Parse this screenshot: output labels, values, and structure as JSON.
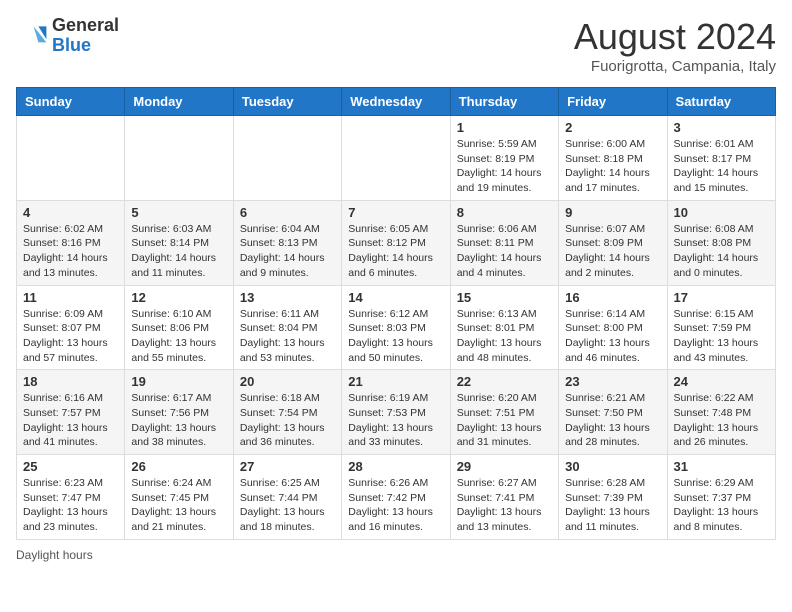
{
  "header": {
    "logo_general": "General",
    "logo_blue": "Blue",
    "month_year": "August 2024",
    "location": "Fuorigrotta, Campania, Italy"
  },
  "footer": {
    "daylight_label": "Daylight hours"
  },
  "days_of_week": [
    "Sunday",
    "Monday",
    "Tuesday",
    "Wednesday",
    "Thursday",
    "Friday",
    "Saturday"
  ],
  "weeks": [
    [
      {
        "day": "",
        "info": ""
      },
      {
        "day": "",
        "info": ""
      },
      {
        "day": "",
        "info": ""
      },
      {
        "day": "",
        "info": ""
      },
      {
        "day": "1",
        "info": "Sunrise: 5:59 AM\nSunset: 8:19 PM\nDaylight: 14 hours and 19 minutes."
      },
      {
        "day": "2",
        "info": "Sunrise: 6:00 AM\nSunset: 8:18 PM\nDaylight: 14 hours and 17 minutes."
      },
      {
        "day": "3",
        "info": "Sunrise: 6:01 AM\nSunset: 8:17 PM\nDaylight: 14 hours and 15 minutes."
      }
    ],
    [
      {
        "day": "4",
        "info": "Sunrise: 6:02 AM\nSunset: 8:16 PM\nDaylight: 14 hours and 13 minutes."
      },
      {
        "day": "5",
        "info": "Sunrise: 6:03 AM\nSunset: 8:14 PM\nDaylight: 14 hours and 11 minutes."
      },
      {
        "day": "6",
        "info": "Sunrise: 6:04 AM\nSunset: 8:13 PM\nDaylight: 14 hours and 9 minutes."
      },
      {
        "day": "7",
        "info": "Sunrise: 6:05 AM\nSunset: 8:12 PM\nDaylight: 14 hours and 6 minutes."
      },
      {
        "day": "8",
        "info": "Sunrise: 6:06 AM\nSunset: 8:11 PM\nDaylight: 14 hours and 4 minutes."
      },
      {
        "day": "9",
        "info": "Sunrise: 6:07 AM\nSunset: 8:09 PM\nDaylight: 14 hours and 2 minutes."
      },
      {
        "day": "10",
        "info": "Sunrise: 6:08 AM\nSunset: 8:08 PM\nDaylight: 14 hours and 0 minutes."
      }
    ],
    [
      {
        "day": "11",
        "info": "Sunrise: 6:09 AM\nSunset: 8:07 PM\nDaylight: 13 hours and 57 minutes."
      },
      {
        "day": "12",
        "info": "Sunrise: 6:10 AM\nSunset: 8:06 PM\nDaylight: 13 hours and 55 minutes."
      },
      {
        "day": "13",
        "info": "Sunrise: 6:11 AM\nSunset: 8:04 PM\nDaylight: 13 hours and 53 minutes."
      },
      {
        "day": "14",
        "info": "Sunrise: 6:12 AM\nSunset: 8:03 PM\nDaylight: 13 hours and 50 minutes."
      },
      {
        "day": "15",
        "info": "Sunrise: 6:13 AM\nSunset: 8:01 PM\nDaylight: 13 hours and 48 minutes."
      },
      {
        "day": "16",
        "info": "Sunrise: 6:14 AM\nSunset: 8:00 PM\nDaylight: 13 hours and 46 minutes."
      },
      {
        "day": "17",
        "info": "Sunrise: 6:15 AM\nSunset: 7:59 PM\nDaylight: 13 hours and 43 minutes."
      }
    ],
    [
      {
        "day": "18",
        "info": "Sunrise: 6:16 AM\nSunset: 7:57 PM\nDaylight: 13 hours and 41 minutes."
      },
      {
        "day": "19",
        "info": "Sunrise: 6:17 AM\nSunset: 7:56 PM\nDaylight: 13 hours and 38 minutes."
      },
      {
        "day": "20",
        "info": "Sunrise: 6:18 AM\nSunset: 7:54 PM\nDaylight: 13 hours and 36 minutes."
      },
      {
        "day": "21",
        "info": "Sunrise: 6:19 AM\nSunset: 7:53 PM\nDaylight: 13 hours and 33 minutes."
      },
      {
        "day": "22",
        "info": "Sunrise: 6:20 AM\nSunset: 7:51 PM\nDaylight: 13 hours and 31 minutes."
      },
      {
        "day": "23",
        "info": "Sunrise: 6:21 AM\nSunset: 7:50 PM\nDaylight: 13 hours and 28 minutes."
      },
      {
        "day": "24",
        "info": "Sunrise: 6:22 AM\nSunset: 7:48 PM\nDaylight: 13 hours and 26 minutes."
      }
    ],
    [
      {
        "day": "25",
        "info": "Sunrise: 6:23 AM\nSunset: 7:47 PM\nDaylight: 13 hours and 23 minutes."
      },
      {
        "day": "26",
        "info": "Sunrise: 6:24 AM\nSunset: 7:45 PM\nDaylight: 13 hours and 21 minutes."
      },
      {
        "day": "27",
        "info": "Sunrise: 6:25 AM\nSunset: 7:44 PM\nDaylight: 13 hours and 18 minutes."
      },
      {
        "day": "28",
        "info": "Sunrise: 6:26 AM\nSunset: 7:42 PM\nDaylight: 13 hours and 16 minutes."
      },
      {
        "day": "29",
        "info": "Sunrise: 6:27 AM\nSunset: 7:41 PM\nDaylight: 13 hours and 13 minutes."
      },
      {
        "day": "30",
        "info": "Sunrise: 6:28 AM\nSunset: 7:39 PM\nDaylight: 13 hours and 11 minutes."
      },
      {
        "day": "31",
        "info": "Sunrise: 6:29 AM\nSunset: 7:37 PM\nDaylight: 13 hours and 8 minutes."
      }
    ]
  ]
}
